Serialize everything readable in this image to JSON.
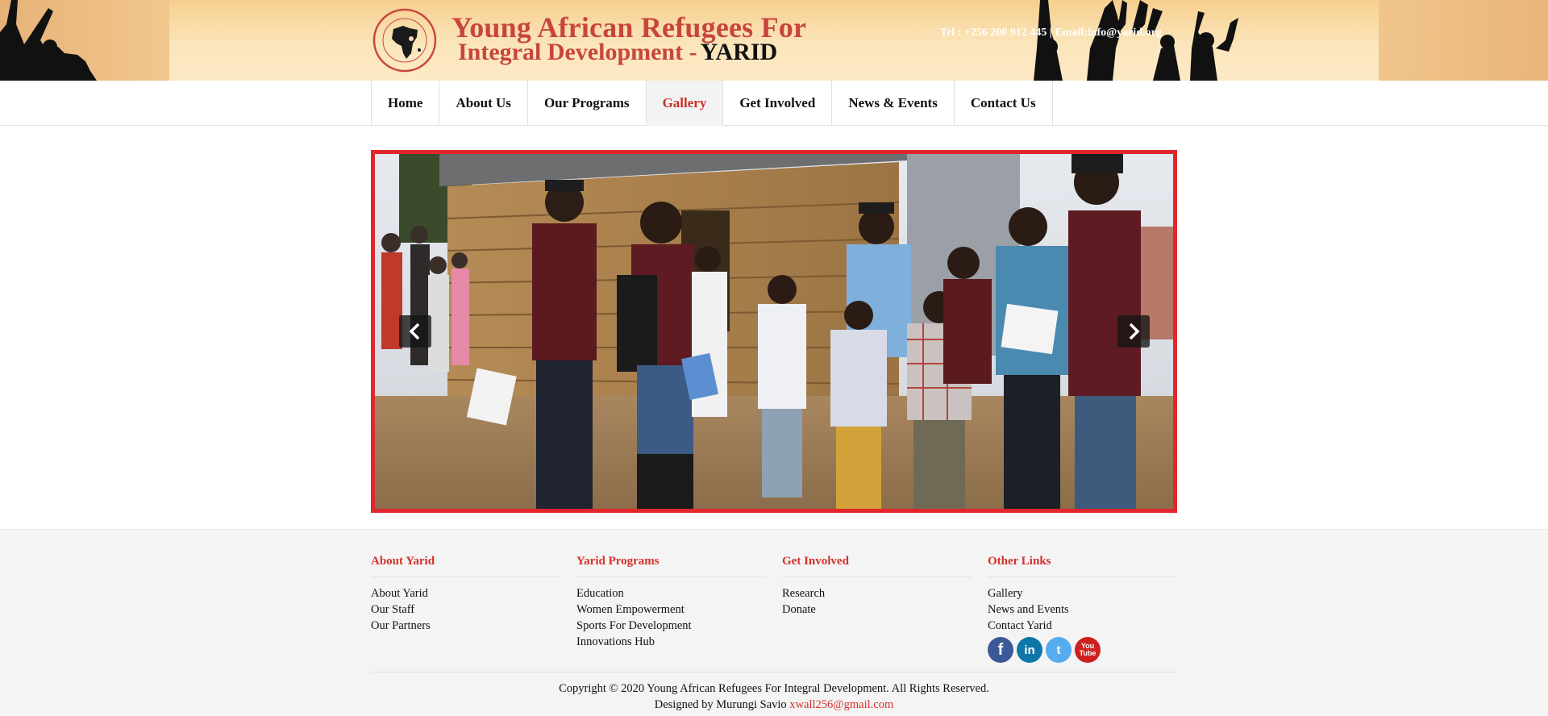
{
  "header": {
    "logo_line1": "Young African Refugees For",
    "logo_line2": "Integral Development  -",
    "logo_abbr": "YARID",
    "emblem_text": "Young African Refugees for Integral Development",
    "emblem_abbr": "YARID",
    "contact": "Tel : +256 200 912 445 | Email:info@yarid.org"
  },
  "nav": {
    "items": [
      {
        "label": "Home"
      },
      {
        "label": "About Us"
      },
      {
        "label": "Our Programs"
      },
      {
        "label": "Gallery"
      },
      {
        "label": "Get Involved"
      },
      {
        "label": "News & Events"
      },
      {
        "label": "Contact Us"
      }
    ],
    "active": "Gallery"
  },
  "slider": {
    "prev_icon": "chevron-left-icon",
    "next_icon": "chevron-right-icon",
    "border_color": "#e1262c"
  },
  "footer": {
    "columns": [
      {
        "title": "About Yarid",
        "links": [
          "About Yarid",
          "Our Staff",
          "Our Partners"
        ]
      },
      {
        "title": "Yarid Programs",
        "links": [
          "Education",
          "Women Empowerment",
          "Sports For Development",
          "Innovations Hub"
        ]
      },
      {
        "title": "Get Involved",
        "links": [
          "Research",
          "Donate"
        ]
      },
      {
        "title": "Other Links",
        "links": [
          "Gallery",
          "News and Events",
          "Contact Yarid"
        ]
      }
    ],
    "socials": [
      {
        "icon": "facebook-icon",
        "glyph": "f"
      },
      {
        "icon": "linkedin-icon",
        "glyph": "in"
      },
      {
        "icon": "twitter-icon",
        "glyph": "t"
      },
      {
        "icon": "youtube-icon",
        "glyph_top": "You",
        "glyph_bottom": "Tube"
      }
    ],
    "copyright": "Copyright © 2020 Young African Refugees For Integral Development. All Rights Reserved.",
    "designed_by": "Designed by Murungi Savio",
    "designer_email": "xwall256@gmail.com"
  },
  "colors": {
    "accent": "#d2312b",
    "banner": "#f7d9a3"
  }
}
